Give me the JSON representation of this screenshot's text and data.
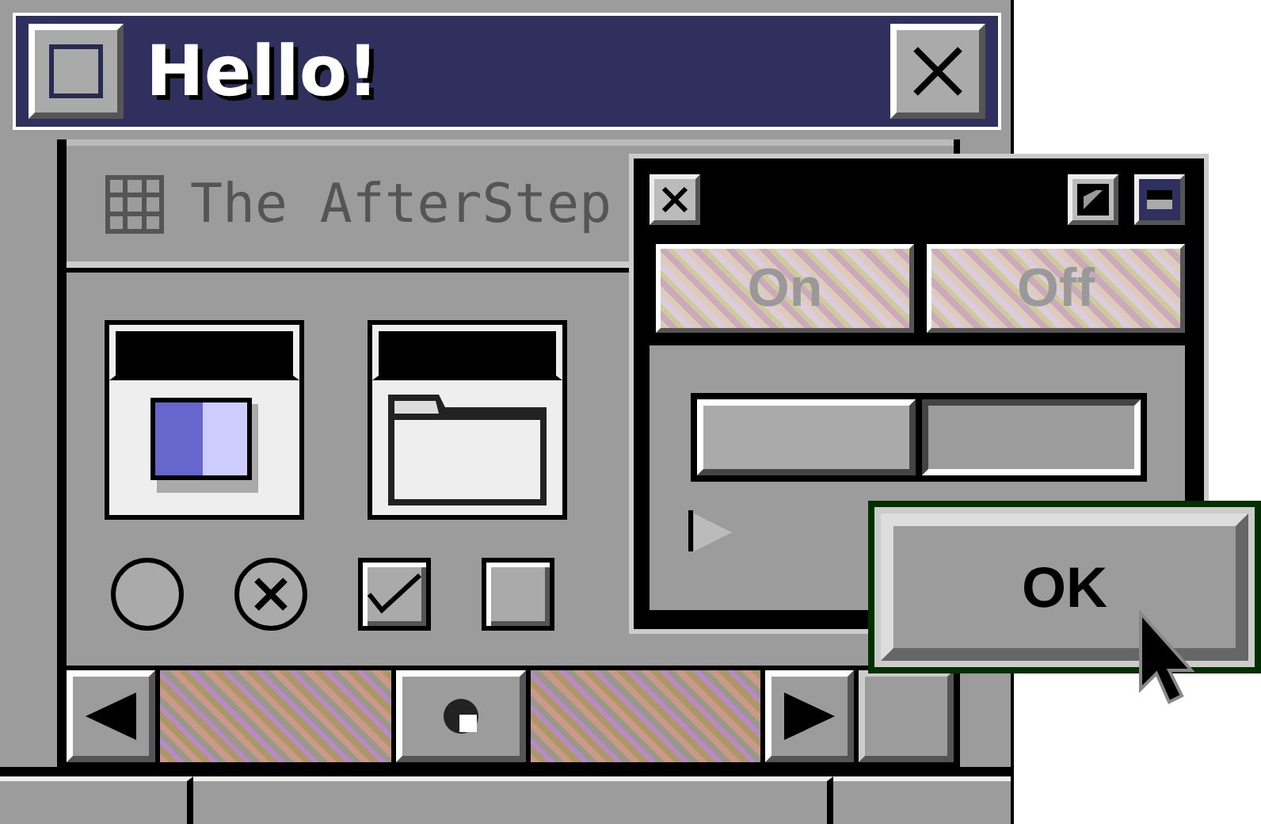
{
  "window": {
    "title": "Hello!"
  },
  "panel": {
    "title": "The AfterStep"
  },
  "icons": [
    {
      "kind": "app"
    },
    {
      "kind": "folder"
    }
  ],
  "controls": [
    {
      "kind": "radio",
      "checked": false
    },
    {
      "kind": "radio",
      "checked": true
    },
    {
      "kind": "checkbox",
      "checked": true
    },
    {
      "kind": "checkbox",
      "checked": false
    }
  ],
  "popup": {
    "toggles": [
      {
        "label": "On",
        "disabled": true
      },
      {
        "label": "Off",
        "disabled": true
      }
    ],
    "segments": [
      {
        "selected": false
      },
      {
        "selected": true
      }
    ]
  },
  "ok_button": {
    "label": "OK"
  }
}
